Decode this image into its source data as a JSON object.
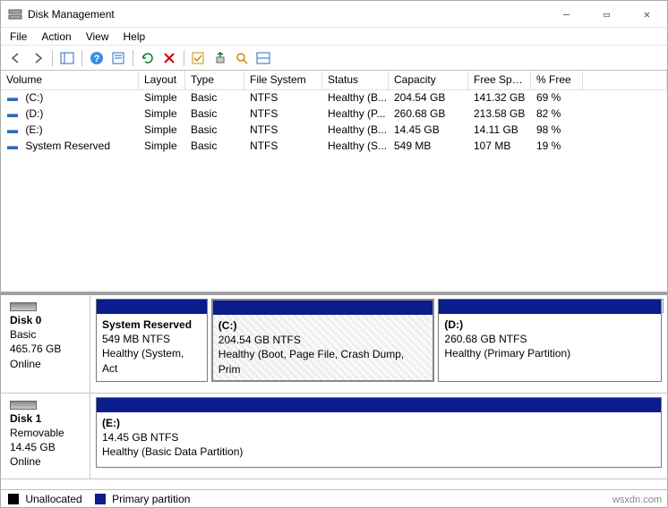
{
  "window": {
    "title": "Disk Management"
  },
  "menu": {
    "file": "File",
    "action": "Action",
    "view": "View",
    "help": "Help"
  },
  "columns": {
    "volume": "Volume",
    "layout": "Layout",
    "type": "Type",
    "fs": "File System",
    "status": "Status",
    "capacity": "Capacity",
    "free": "Free Spa...",
    "pct": "% Free"
  },
  "volumes": [
    {
      "icon": "drive",
      "name": " (C:)",
      "layout": "Simple",
      "type": "Basic",
      "fs": "NTFS",
      "status": "Healthy (B...",
      "capacity": "204.54 GB",
      "free": "141.32 GB",
      "pct": "69 %"
    },
    {
      "icon": "drive",
      "name": " (D:)",
      "layout": "Simple",
      "type": "Basic",
      "fs": "NTFS",
      "status": "Healthy (P...",
      "capacity": "260.68 GB",
      "free": "213.58 GB",
      "pct": "82 %"
    },
    {
      "icon": "drive",
      "name": " (E:)",
      "layout": "Simple",
      "type": "Basic",
      "fs": "NTFS",
      "status": "Healthy (B...",
      "capacity": "14.45 GB",
      "free": "14.11 GB",
      "pct": "98 %"
    },
    {
      "icon": "drive",
      "name": " System Reserved",
      "layout": "Simple",
      "type": "Basic",
      "fs": "NTFS",
      "status": "Healthy (S...",
      "capacity": "549 MB",
      "free": "107 MB",
      "pct": "19 %"
    }
  ],
  "disks": [
    {
      "label": "Disk 0",
      "kind": "Basic",
      "size": "465.76 GB",
      "state": "Online",
      "partitions": [
        {
          "title": "System Reserved",
          "sub": "549 MB NTFS",
          "health": "Healthy (System, Act",
          "widthPct": 20,
          "hatched": false
        },
        {
          "title": "(C:)",
          "sub": "204.54 GB NTFS",
          "health": "Healthy (Boot, Page File, Crash Dump, Prim",
          "widthPct": 40,
          "hatched": true
        },
        {
          "title": "(D:)",
          "sub": "260.68 GB NTFS",
          "health": "Healthy (Primary Partition)",
          "widthPct": 40,
          "hatched": false
        }
      ]
    },
    {
      "label": "Disk 1",
      "kind": "Removable",
      "size": "14.45 GB",
      "state": "Online",
      "partitions": [
        {
          "title": "(E:)",
          "sub": "14.45 GB NTFS",
          "health": "Healthy (Basic Data Partition)",
          "widthPct": 100,
          "hatched": false
        }
      ]
    }
  ],
  "legend": {
    "unallocated": "Unallocated",
    "primary": "Primary partition"
  },
  "watermark": "wsxdn.com"
}
